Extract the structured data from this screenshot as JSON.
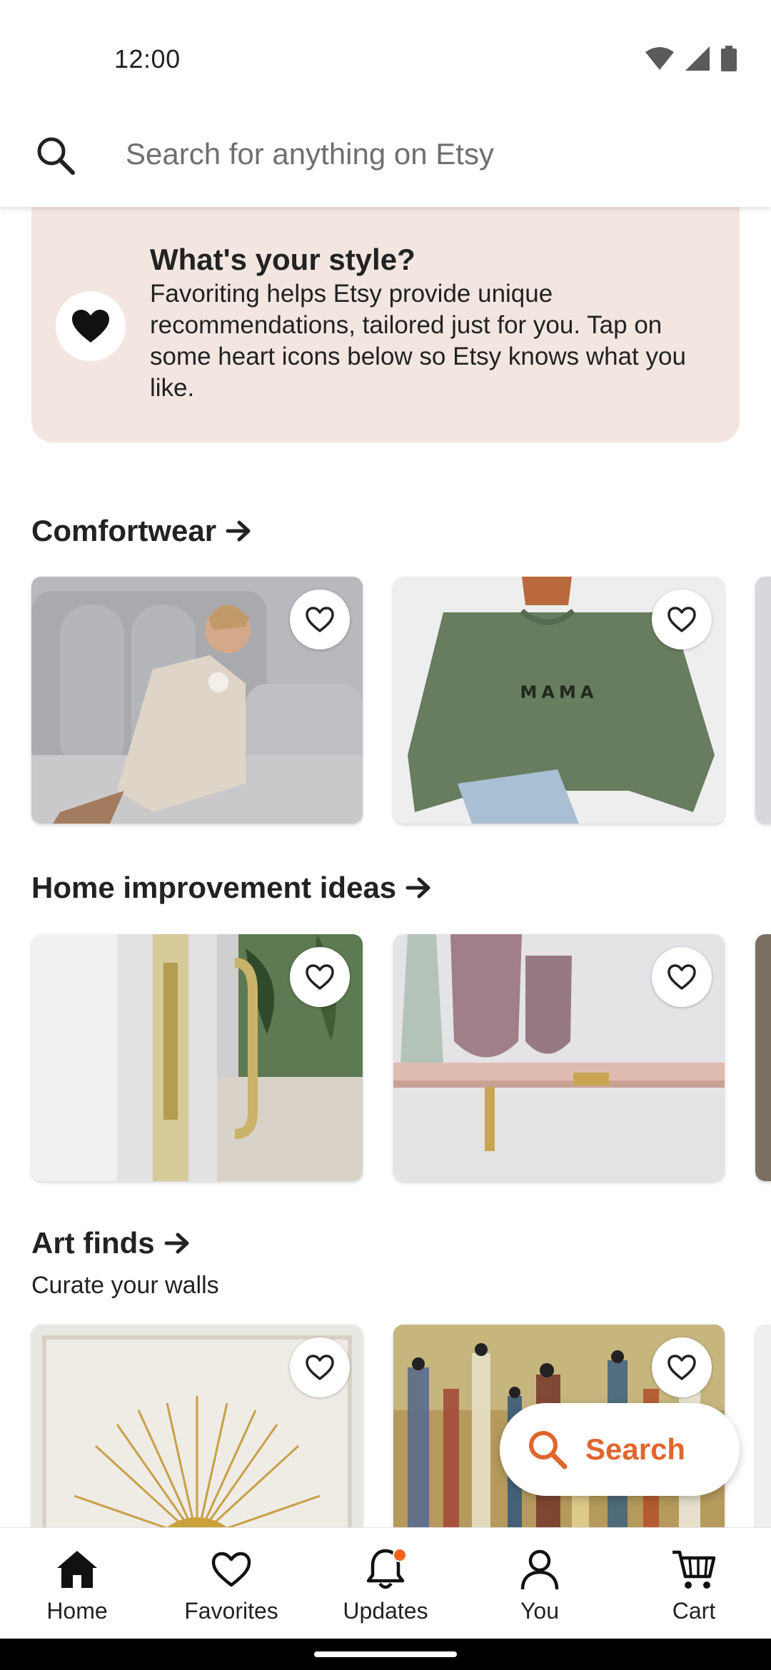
{
  "status_bar": {
    "time": "12:00"
  },
  "search": {
    "placeholder": "Search for anything on Etsy"
  },
  "style_card": {
    "title": "What's your style?",
    "body": "Favoriting helps Etsy provide unique recommendations, tailored just for you. Tap on some heart icons below so Etsy knows what you like."
  },
  "sections": [
    {
      "title": "Comfortwear",
      "items": [
        {
          "name": "linen-robe-listing"
        },
        {
          "name": "mama-sweatshirt-listing",
          "print": "MAMA"
        }
      ]
    },
    {
      "title": "Home improvement ideas",
      "items": [
        {
          "name": "door-pull-handle-listing"
        },
        {
          "name": "shelf-bracket-listing"
        }
      ]
    },
    {
      "title": "Art finds",
      "subtitle": "Curate your walls",
      "items": [
        {
          "name": "sun-print-listing"
        },
        {
          "name": "abstract-painting-listing"
        }
      ]
    }
  ],
  "fab": {
    "label": "Search"
  },
  "nav": {
    "items": [
      {
        "label": "Home",
        "icon": "home-icon",
        "active": true
      },
      {
        "label": "Favorites",
        "icon": "heart-icon"
      },
      {
        "label": "Updates",
        "icon": "bell-icon",
        "badge": true
      },
      {
        "label": "You",
        "icon": "person-icon"
      },
      {
        "label": "Cart",
        "icon": "cart-icon"
      }
    ]
  },
  "colors": {
    "accent": "#f1641e",
    "fab_text": "#e0662c",
    "style_card_bg": "#f3e6e1"
  }
}
